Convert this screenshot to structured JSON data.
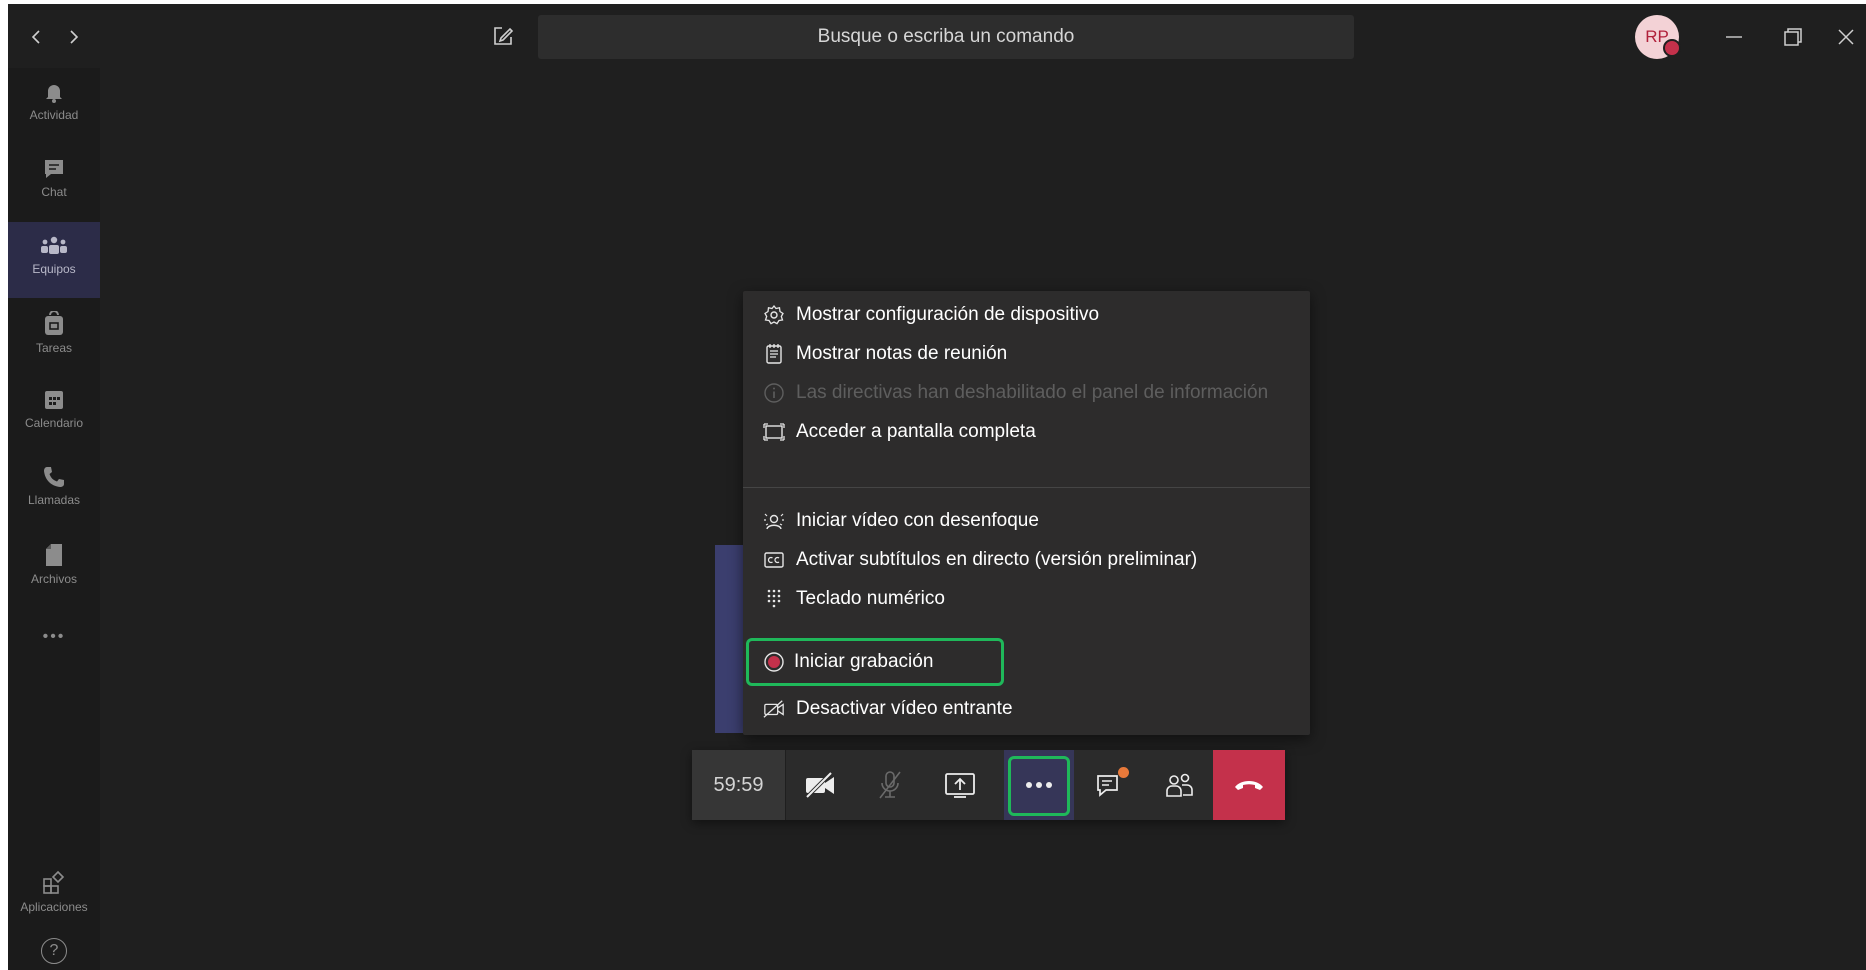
{
  "titlebar": {
    "search_placeholder": "Busque o escriba un comando",
    "avatar_initials": "RP",
    "nav_back_icon": "chevron-left-icon",
    "nav_forward_icon": "chevron-right-icon"
  },
  "rail": {
    "items": [
      {
        "label": "Actividad",
        "icon": "bell-icon"
      },
      {
        "label": "Chat",
        "icon": "chat-icon"
      },
      {
        "label": "Equipos",
        "icon": "teams-icon",
        "active": true
      },
      {
        "label": "Tareas",
        "icon": "tasks-icon"
      },
      {
        "label": "Calendario",
        "icon": "calendar-icon"
      },
      {
        "label": "Llamadas",
        "icon": "phone-icon"
      },
      {
        "label": "Archivos",
        "icon": "file-icon"
      }
    ],
    "more_label": "•••",
    "apps_label": "Aplicaciones",
    "help_label": "?"
  },
  "menu": {
    "items": [
      {
        "label": "Mostrar configuración de dispositivo",
        "icon": "gear-icon"
      },
      {
        "label": "Mostrar notas de reunión",
        "icon": "notes-icon"
      },
      {
        "label": "Las directivas han deshabilitado el panel de información",
        "icon": "info-icon",
        "disabled": true
      },
      {
        "label": "Acceder a pantalla completa",
        "icon": "fullscreen-icon"
      },
      {
        "label": "Iniciar vídeo con desenfoque",
        "icon": "blur-icon"
      },
      {
        "label": "Activar subtítulos en directo (versión preliminar)",
        "icon": "captions-icon"
      },
      {
        "label": "Teclado numérico",
        "icon": "dialpad-icon"
      },
      {
        "label": "Iniciar grabación",
        "icon": "record-icon"
      },
      {
        "label": "Desactivar vídeo entrante",
        "icon": "video-off-icon"
      }
    ]
  },
  "callbar": {
    "timer": "59:59"
  },
  "colors": {
    "background": "#1f1f1f",
    "accent_highlight": "#1fb85a",
    "hangup": "#c4314b",
    "record": "#c4314b",
    "active_rail": "#2c2c48"
  }
}
